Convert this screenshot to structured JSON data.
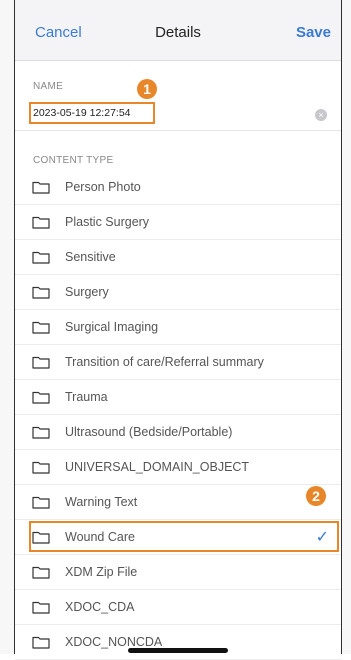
{
  "header": {
    "cancel_label": "Cancel",
    "title": "Details",
    "save_label": "Save"
  },
  "name_section": {
    "label": "NAME",
    "value": "2023-05-19 12:27:54",
    "clear_icon": "clear-circle-icon"
  },
  "annotations": {
    "badge_1": "1",
    "badge_2": "2"
  },
  "content_type_section": {
    "label": "CONTENT TYPE",
    "items": [
      {
        "label": "Person Photo",
        "selected": false
      },
      {
        "label": "Plastic Surgery",
        "selected": false
      },
      {
        "label": "Sensitive",
        "selected": false
      },
      {
        "label": "Surgery",
        "selected": false
      },
      {
        "label": "Surgical Imaging",
        "selected": false
      },
      {
        "label": "Transition of care/Referral summary",
        "selected": false
      },
      {
        "label": "Trauma",
        "selected": false
      },
      {
        "label": "Ultrasound (Bedside/Portable)",
        "selected": false
      },
      {
        "label": "UNIVERSAL_DOMAIN_OBJECT",
        "selected": false
      },
      {
        "label": "Warning Text",
        "selected": false
      },
      {
        "label": "Wound Care",
        "selected": true
      },
      {
        "label": "XDM Zip File",
        "selected": false
      },
      {
        "label": "XDOC_CDA",
        "selected": false
      },
      {
        "label": "XDOC_NONCDA",
        "selected": false
      }
    ],
    "check_glyph": "✓"
  },
  "colors": {
    "accent": "#3a7bd5",
    "highlight": "#e8862a"
  }
}
